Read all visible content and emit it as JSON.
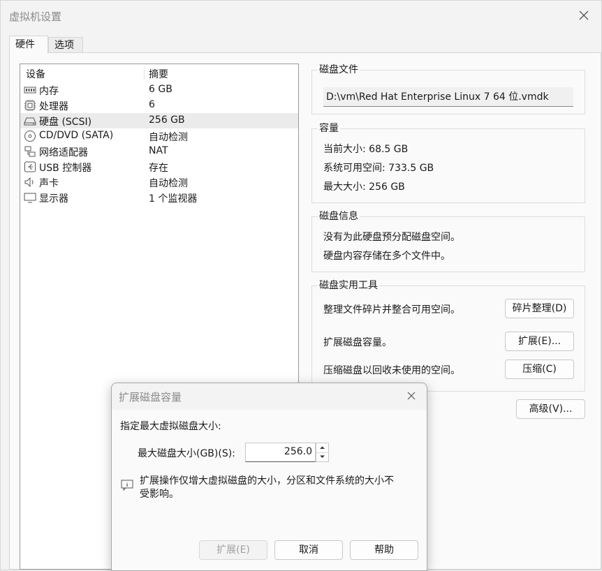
{
  "window": {
    "title": "虚拟机设置"
  },
  "tabs": [
    {
      "label": "硬件"
    },
    {
      "label": "选项"
    }
  ],
  "device_list": {
    "columns": {
      "device": "设备",
      "summary": "摘要"
    },
    "rows": [
      {
        "name": "内存",
        "summary": "6 GB",
        "icon": "memory-icon"
      },
      {
        "name": "处理器",
        "summary": "6",
        "icon": "processor-icon"
      },
      {
        "name": "硬盘 (SCSI)",
        "summary": "256 GB",
        "icon": "hard-disk-icon",
        "selected": true
      },
      {
        "name": "CD/DVD (SATA)",
        "summary": "自动检测",
        "icon": "cd-dvd-icon"
      },
      {
        "name": "网络适配器",
        "summary": "NAT",
        "icon": "network-icon"
      },
      {
        "name": "USB 控制器",
        "summary": "存在",
        "icon": "usb-icon"
      },
      {
        "name": "声卡",
        "summary": "自动检测",
        "icon": "sound-icon"
      },
      {
        "name": "显示器",
        "summary": "1 个监视器",
        "icon": "display-icon"
      }
    ]
  },
  "disk_file": {
    "title": "磁盘文件",
    "path": "D:\\vm\\Red Hat Enterprise Linux 7 64 位.vmdk"
  },
  "capacity": {
    "title": "容量",
    "current_size": "当前大小: 68.5 GB",
    "available": "系统可用空间: 733.5 GB",
    "max_size": "最大大小: 256 GB"
  },
  "disk_info": {
    "title": "磁盘信息",
    "line1": "没有为此硬盘预分配磁盘空间。",
    "line2": "硬盘内容存储在多个文件中。"
  },
  "utilities": {
    "title": "磁盘实用工具",
    "defrag_text": "整理文件碎片并整合可用空间。",
    "defrag_button": "碎片整理(D)",
    "expand_text": "扩展磁盘容量。",
    "expand_button": "扩展(E)...",
    "compact_text": "压缩磁盘以回收未使用的空间。",
    "compact_button": "压缩(C)"
  },
  "advanced_button": "高级(V)...",
  "dialog": {
    "title": "扩展磁盘容量",
    "prompt": "指定最大虚拟磁盘大小:",
    "size_label": "最大磁盘大小(GB)(S):",
    "size_value": "256.0",
    "info_line1": "扩展操作仅增大虚拟磁盘的大小，分区和文件系统的大小不",
    "info_line2": "受影响。",
    "expand_button": "扩展(E)",
    "cancel_button": "取消",
    "help_button": "帮助"
  }
}
